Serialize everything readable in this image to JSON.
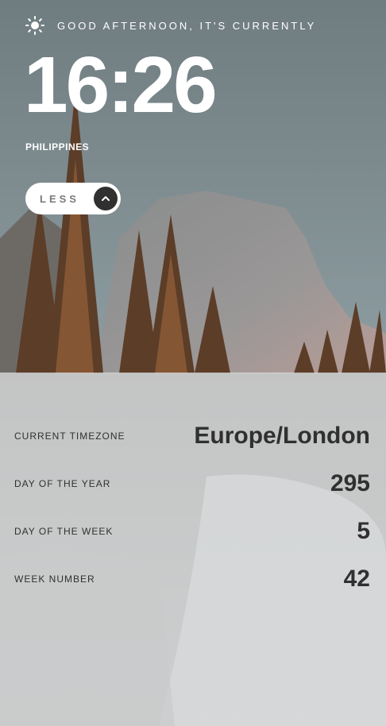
{
  "header": {
    "greeting": "GOOD AFTERNOON, IT'S CURRENTLY",
    "icon": "sun-icon",
    "time": "16:26",
    "location": "PHILIPPINES"
  },
  "toggle": {
    "label": "LESS",
    "icon": "chevron-up-icon"
  },
  "details": {
    "rows": [
      {
        "label": "CURRENT TIMEZONE",
        "value": "Europe/London"
      },
      {
        "label": "DAY OF THE YEAR",
        "value": "295"
      },
      {
        "label": "DAY OF THE WEEK",
        "value": "5"
      },
      {
        "label": "WEEK NUMBER",
        "value": "42"
      }
    ]
  },
  "colors": {
    "text_light": "#ffffff",
    "text_dark": "#303030",
    "button_bg": "#ffffff",
    "button_circle": "#303030",
    "panel_bg": "#e6e8e9"
  }
}
